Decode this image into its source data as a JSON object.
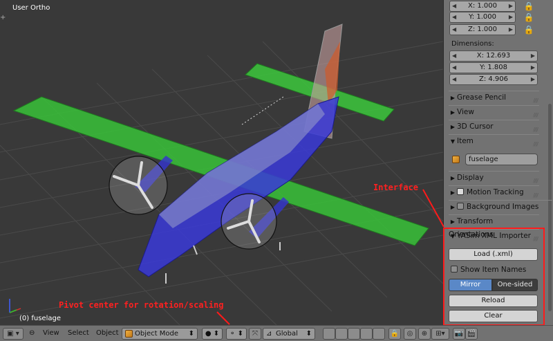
{
  "viewport": {
    "view_label": "User Ortho",
    "object_label": "(0) fuselage"
  },
  "properties": {
    "scale": [
      {
        "axis": "X:",
        "value": "1.000"
      },
      {
        "axis": "Y:",
        "value": "1.000"
      },
      {
        "axis": "Z:",
        "value": "1.000"
      }
    ],
    "dimensions_label": "Dimensions:",
    "dimensions": [
      {
        "axis": "X:",
        "value": "12.693"
      },
      {
        "axis": "Y:",
        "value": "1.808"
      },
      {
        "axis": "Z:",
        "value": "4.906"
      }
    ],
    "sections": {
      "grease_pencil": "Grease Pencil",
      "view": "View",
      "cursor_3d": "3D Cursor",
      "item": "Item",
      "display": "Display",
      "motion_tracking": "Motion Tracking",
      "background_images": "Background Images",
      "transform_orientations": "Transform Orientations",
      "yasim": "YASim XML Importer"
    },
    "item_name": "fuselage",
    "yasim": {
      "load_label": "Load (.xml)",
      "show_item_names": "Show Item Names",
      "mirror": "Mirror",
      "one_sided": "One-sided",
      "reload": "Reload",
      "clear": "Clear"
    }
  },
  "annotations": {
    "interface": "Interface",
    "pivot": "Pivot center for rotation/scaling"
  },
  "header": {
    "menu_view": "View",
    "menu_select": "Select",
    "menu_object": "Object",
    "mode": "Object Mode",
    "orientation": "Global"
  },
  "colors": {
    "annotation_red": "#ff1a1a",
    "mirror_active": "#5a88c7",
    "wing_green": "#3cc43c",
    "fuselage_blue": "#3a3ad8"
  }
}
